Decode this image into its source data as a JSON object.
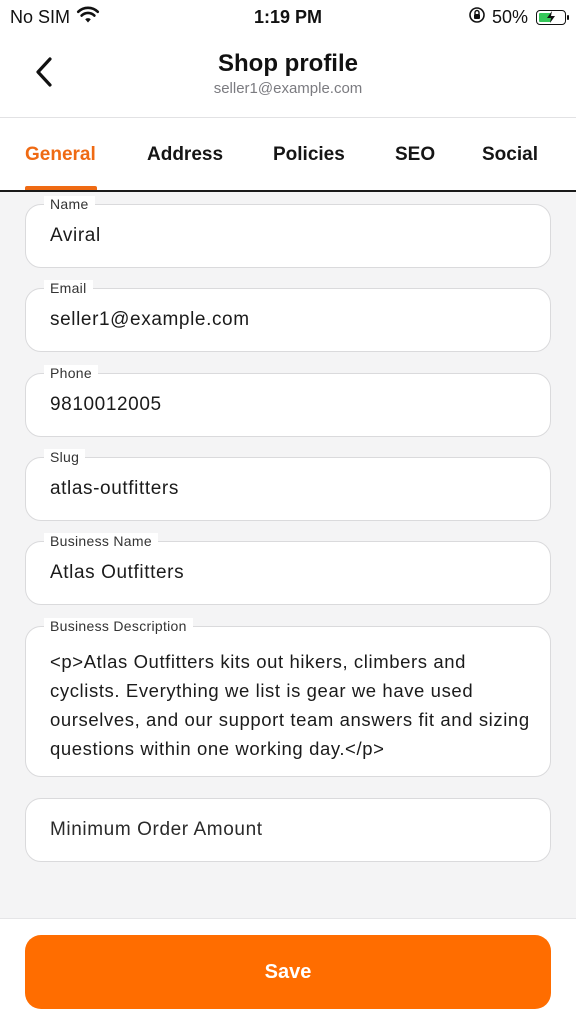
{
  "status_bar": {
    "carrier": "No SIM",
    "time": "1:19 PM",
    "battery": "50%"
  },
  "header": {
    "title": "Shop profile",
    "subtitle": "seller1@example.com"
  },
  "tabs": [
    {
      "label": "General",
      "active": true
    },
    {
      "label": "Address"
    },
    {
      "label": "Policies"
    },
    {
      "label": "SEO"
    },
    {
      "label": "Social"
    }
  ],
  "form": {
    "name": {
      "label": "Name",
      "value": "Aviral"
    },
    "email": {
      "label": "Email",
      "value": "seller1@example.com"
    },
    "phone": {
      "label": "Phone",
      "value": "9810012005"
    },
    "slug": {
      "label": "Slug",
      "value": "atlas-outfitters"
    },
    "business_name": {
      "label": "Business Name",
      "value": "Atlas Outfitters"
    },
    "business_description": {
      "label": "Business Description",
      "value": "<p>Atlas Outfitters kits out hikers, climbers and cyclists. Everything we list is gear we have used ourselves, and our support team answers fit and sizing questions within one working day.</p>"
    },
    "minimum_order_amount": {
      "placeholder": "Minimum Order Amount"
    }
  },
  "footer": {
    "save_label": "Save"
  },
  "colors": {
    "accent": "#ff6d00",
    "tab_active": "#ef6a13",
    "battery": "#35c759"
  }
}
